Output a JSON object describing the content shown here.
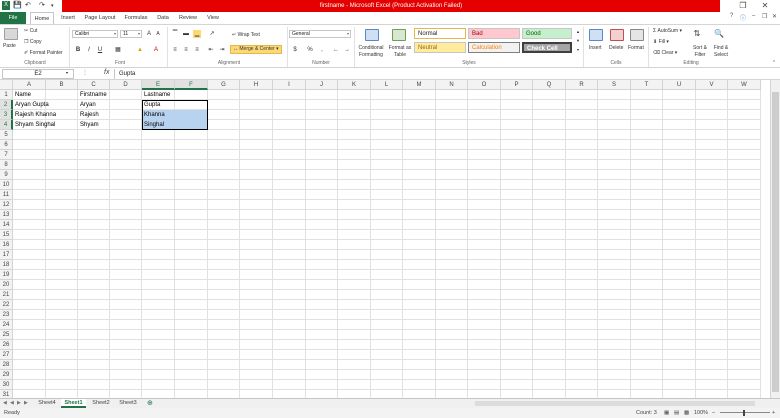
{
  "window": {
    "title": "firstname - Microsoft Excel (Product Activation Failed)"
  },
  "ribbon_tabs": [
    "File",
    "Home",
    "Insert",
    "Page Layout",
    "Formulas",
    "Data",
    "Review",
    "View"
  ],
  "clipboard": {
    "paste": "Paste",
    "cut": "Cut",
    "copy": "Copy",
    "format_painter": "Format Painter",
    "label": "Clipboard"
  },
  "font": {
    "name": "Calibri",
    "size": "11",
    "label": "Font"
  },
  "alignment": {
    "wrap_text": "Wrap Text",
    "merge_center": "Merge & Center",
    "label": "Alignment"
  },
  "number": {
    "format": "General",
    "currency": "$",
    "percent": "%",
    "comma": ",",
    "label": "Number"
  },
  "styles": {
    "conditional_formatting": "Conditional Formatting",
    "format_as_table": "Format as Table",
    "normal": "Normal",
    "bad": "Bad",
    "good": "Good",
    "neutral": "Neutral",
    "calculation": "Calculation",
    "check_cell": "Check Cell",
    "label": "Styles"
  },
  "cells_group": {
    "insert": "Insert",
    "delete": "Delete",
    "format": "Format",
    "label": "Cells"
  },
  "editing": {
    "autosum": "AutoSum",
    "fill": "Fill",
    "clear": "Clear",
    "sort_filter": "Sort & Filter",
    "find_select": "Find & Select",
    "label": "Editing"
  },
  "formula_bar": {
    "name_box": "E2",
    "fx": "fx",
    "value": "Gupta"
  },
  "columns": [
    "A",
    "B",
    "C",
    "D",
    "E",
    "F",
    "G",
    "H",
    "I",
    "J",
    "K",
    "L",
    "M",
    "N",
    "O",
    "P",
    "Q",
    "R",
    "S",
    "T",
    "U",
    "V",
    "W"
  ],
  "rows": [
    "1",
    "2",
    "3",
    "4",
    "5",
    "6",
    "7",
    "8",
    "9",
    "10",
    "11",
    "12",
    "13",
    "14",
    "15",
    "16",
    "17",
    "18",
    "19",
    "20",
    "21",
    "22",
    "23",
    "24",
    "25",
    "26",
    "27",
    "28",
    "29",
    "30",
    "31"
  ],
  "cells": {
    "A1": "Name",
    "C1": "Firstname",
    "E1": "Lastname",
    "A2": "Aryan Gupta",
    "C2": "Aryan",
    "E2": "Gupta",
    "A3": "Rajesh Khanna",
    "C3": "Rajesh",
    "E3": "Khanna",
    "A4": "Shyam Singhal",
    "C4": "Shyam",
    "E4": "Singhal"
  },
  "sheet_tabs": [
    "Sheet4",
    "Sheet1",
    "Sheet2",
    "Sheet3"
  ],
  "active_sheet": "Sheet1",
  "status": {
    "mode": "Ready",
    "count": "Count: 3",
    "zoom": "100%"
  },
  "colors": {
    "excel_green": "#217346",
    "title_red": "#e40000",
    "selection": "#b8d3f0"
  }
}
